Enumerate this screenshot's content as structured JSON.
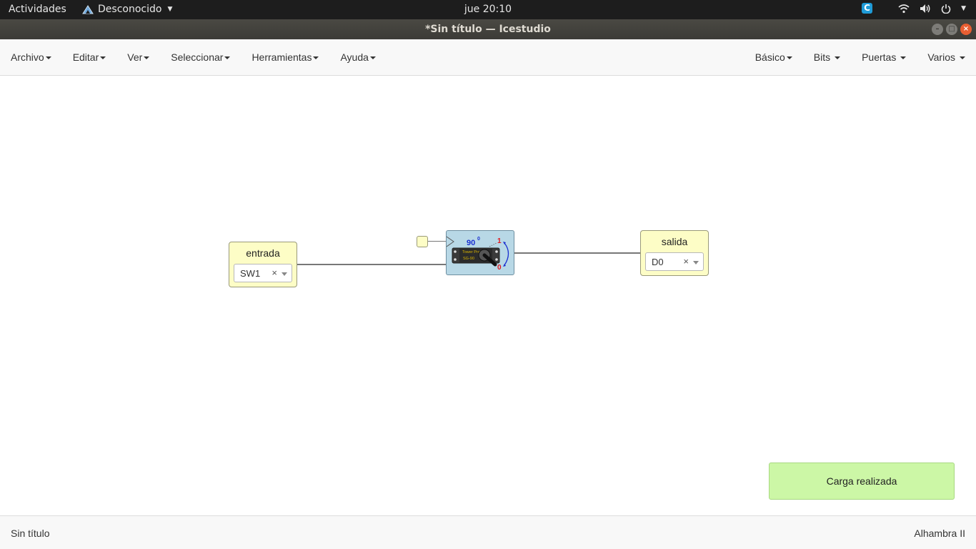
{
  "topbar": {
    "activities": "Actividades",
    "app_menu": "Desconocido",
    "clock": "jue 20:10",
    "icons": [
      "icestudio-tray-icon",
      "wifi-icon",
      "volume-icon",
      "power-icon",
      "chevron-down-icon"
    ]
  },
  "window": {
    "title": "*Sin título — Icestudio"
  },
  "menubar": {
    "left": [
      "Archivo",
      "Editar",
      "Ver",
      "Seleccionar",
      "Herramientas",
      "Ayuda"
    ],
    "right": [
      "Básico",
      "Bits",
      "Puertas",
      "Varios"
    ]
  },
  "canvas": {
    "input_block": {
      "label": "entrada",
      "value": "SW1",
      "clear": "×"
    },
    "output_block": {
      "label": "salida",
      "value": "D0",
      "clear": "×"
    },
    "servo_block": {
      "angle_label": "90",
      "degree": "0",
      "high": "1",
      "low": "0",
      "brand": "Tower Pro",
      "model": "SG-90",
      "icon": "servo-icon"
    }
  },
  "toast": {
    "message": "Carga realizada",
    "color": "#ccf7a6"
  },
  "footer": {
    "left": "Sin título",
    "right": "Alhambra II"
  }
}
